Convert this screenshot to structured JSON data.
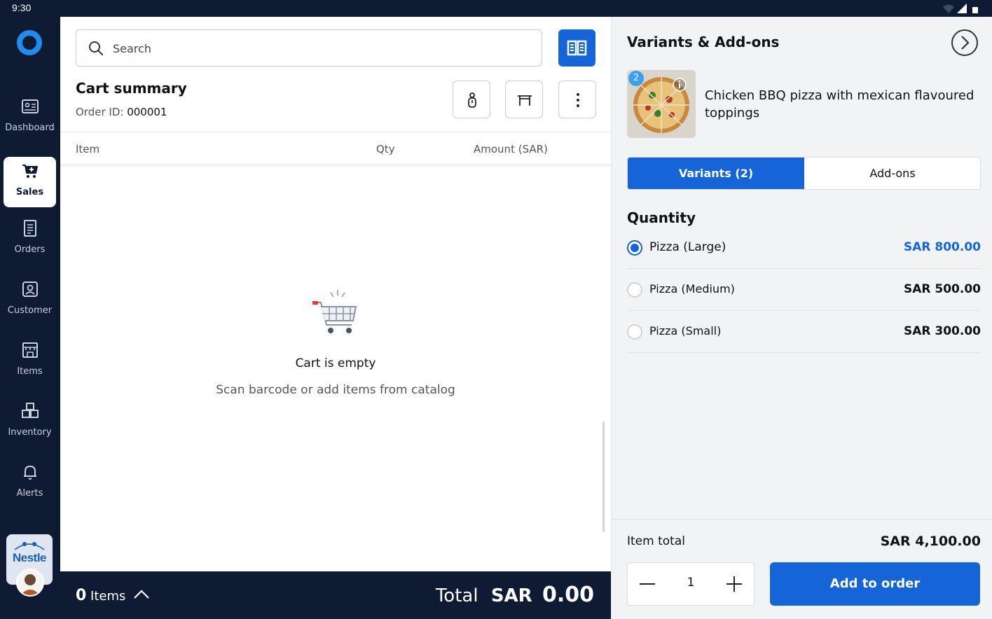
{
  "status_bar": {
    "time": "9:30"
  },
  "sidebar": {
    "items": [
      {
        "label": "Dashboard",
        "icon": "dashboard-icon",
        "active": false
      },
      {
        "label": "Sales",
        "icon": "cart-plus-icon",
        "active": true
      },
      {
        "label": "Orders",
        "icon": "orders-icon",
        "active": false
      },
      {
        "label": "Customer",
        "icon": "customer-icon",
        "active": false
      },
      {
        "label": "Items",
        "icon": "store-icon",
        "active": false
      },
      {
        "label": "Inventory",
        "icon": "inventory-icon",
        "active": false
      },
      {
        "label": "Alerts",
        "icon": "bell-icon",
        "active": false
      }
    ],
    "brand": "Nestle"
  },
  "main": {
    "search": {
      "placeholder": "Search"
    },
    "cart": {
      "title": "Cart summary",
      "order_id_label": "Order ID:",
      "order_id": "000001"
    },
    "table_headers": {
      "item": "Item",
      "qty": "Qty",
      "amount": "Amount (SAR)"
    },
    "empty_state": {
      "title": "Cart is empty",
      "subtitle": "Scan barcode or add items from catalog"
    }
  },
  "footer": {
    "items_count": "0",
    "items_label": "Items",
    "total_label": "Total",
    "total_currency": "SAR",
    "total_value": "0.00"
  },
  "panel": {
    "title": "Variants & Add-ons",
    "product": {
      "name": "Chicken BBQ pizza with mexican flavoured toppings",
      "badge": "2"
    },
    "tabs": [
      {
        "label": "Variants (2)",
        "active": true
      },
      {
        "label": "Add-ons",
        "active": false
      }
    ],
    "quantity_heading": "Quantity",
    "variants": [
      {
        "name": "Pizza (Large)",
        "price": "SAR 800.00",
        "selected": true
      },
      {
        "name": "Pizza (Medium)",
        "price": "SAR 500.00",
        "selected": false
      },
      {
        "name": "Pizza (Small)",
        "price": "SAR 300.00",
        "selected": false
      }
    ],
    "item_total_label": "Item total",
    "item_total_value": "SAR 4,100.00",
    "quantity_value": "1",
    "add_button": "Add to order"
  },
  "colors": {
    "sidebar_bg": "#0e1b33",
    "accent": "#1565d8",
    "panel_bg": "#f2f3f5"
  }
}
